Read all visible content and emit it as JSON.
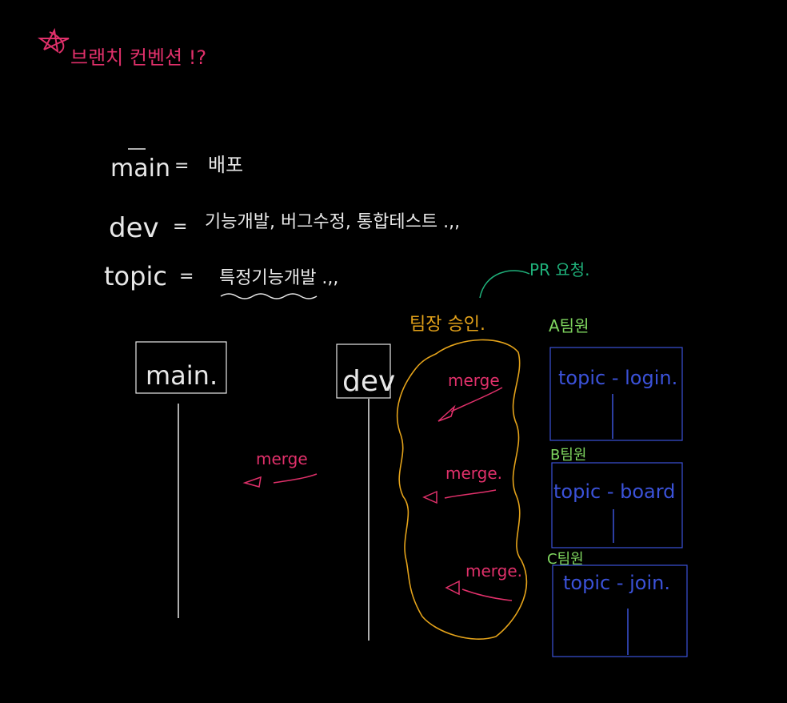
{
  "colors": {
    "background": "#000000",
    "white": "#e8e8e8",
    "pink": "#e0306a",
    "orange": "#e3a21a",
    "green": "#1fb07a",
    "light_green": "#7fd65f",
    "blue": "#3b52d9"
  },
  "title": "브랜치 컨벤션 !?",
  "definitions": [
    {
      "term": "main",
      "eq": "=",
      "desc": "배포"
    },
    {
      "term": "dev",
      "eq": "=",
      "desc": "기능개발, 버그수정, 통합테스트 .,,"
    },
    {
      "term": "topic",
      "eq": "=",
      "desc": "특정기능개발 .,,"
    }
  ],
  "branches": {
    "main": "main.",
    "dev": "dev",
    "topic_login": "topic - login.",
    "topic_board": "topic - board",
    "topic_join": "topic - join."
  },
  "labels": {
    "pr_request": "PR 요청.",
    "leader_approval": "팀장 승인.",
    "member_a": "A팀원",
    "member_b": "B팀원",
    "member_c": "C팀원"
  },
  "merges": {
    "dev_to_main": "merge",
    "login_to_dev": "merge",
    "board_to_dev": "merge.",
    "join_to_dev": "merge."
  }
}
